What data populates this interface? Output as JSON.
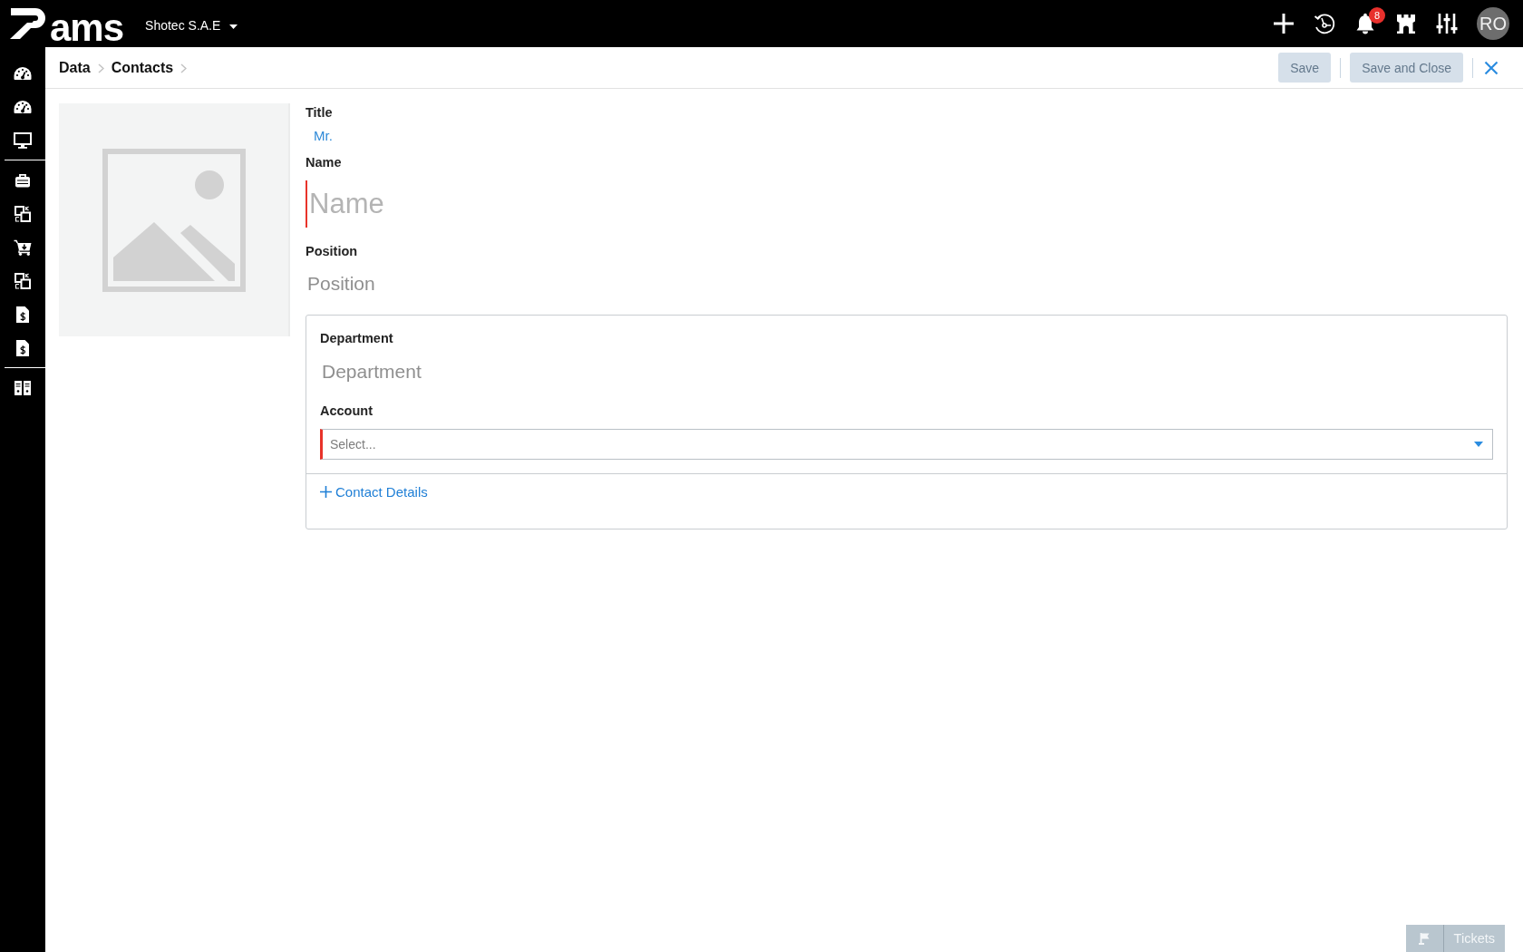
{
  "topbar": {
    "logo_text": "ams",
    "company": "Shotec S.A.E",
    "notification_count": "8",
    "avatar_initials": "RO"
  },
  "breadcrumb": [
    {
      "label": "Data"
    },
    {
      "label": "Contacts"
    }
  ],
  "actions": [
    {
      "label": "Save",
      "disabled": true
    },
    {
      "label": "Save and Close",
      "disabled": true
    }
  ],
  "form": {
    "fields": [
      {
        "kind": "choice",
        "label": "Title",
        "value": "Mr."
      },
      {
        "kind": "large_text",
        "label": "Name",
        "placeholder": "Name",
        "required": true
      },
      {
        "kind": "text",
        "label": "Position",
        "placeholder": "Position",
        "required": false
      }
    ],
    "details": {
      "fields": [
        {
          "kind": "text",
          "label": "Department",
          "placeholder": "Department",
          "required": false
        },
        {
          "kind": "select",
          "label": "Account",
          "placeholder": "Select...",
          "required": true
        }
      ],
      "add_link": "Contact Details"
    }
  },
  "tickets_button": "Tickets"
}
